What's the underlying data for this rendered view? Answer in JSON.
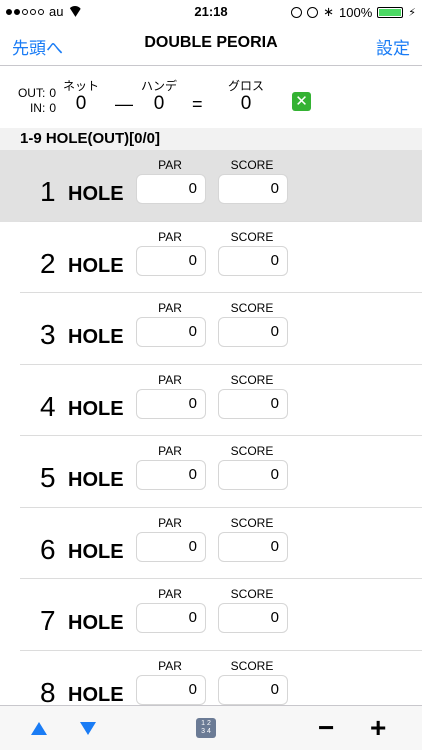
{
  "status": {
    "carrier": "au",
    "time": "21:18",
    "battery": "100%"
  },
  "nav": {
    "back": "先頭へ",
    "title": "DOUBLE PEORIA",
    "settings": "設定"
  },
  "summary": {
    "out_label": "OUT:",
    "out_value": "0",
    "in_label": "IN:",
    "in_value": "0",
    "net_label": "ネット",
    "net_value": "0",
    "minus": "—",
    "handicap_label": "ハンデ",
    "handicap_value": "0",
    "equals": "=",
    "gross_label": "グロス",
    "gross_value": "0",
    "clear_glyph": "✕"
  },
  "section": {
    "title": "1-9 HOLE(OUT)[0/0]"
  },
  "labels": {
    "hole": "HOLE",
    "par": "PAR",
    "score": "SCORE"
  },
  "holes": [
    {
      "num": "1",
      "par": "0",
      "score": "0"
    },
    {
      "num": "2",
      "par": "0",
      "score": "0"
    },
    {
      "num": "3",
      "par": "0",
      "score": "0"
    },
    {
      "num": "4",
      "par": "0",
      "score": "0"
    },
    {
      "num": "5",
      "par": "0",
      "score": "0"
    },
    {
      "num": "6",
      "par": "0",
      "score": "0"
    },
    {
      "num": "7",
      "par": "0",
      "score": "0"
    },
    {
      "num": "8",
      "par": "0",
      "score": "0"
    }
  ],
  "toolbar": {
    "keypad_glyph": "1 2\n3 4",
    "minus": "−",
    "plus": "+"
  },
  "colors": {
    "accent": "#1a7cf5",
    "clear": "#34b233",
    "selected_row": "#e1e1e1"
  }
}
